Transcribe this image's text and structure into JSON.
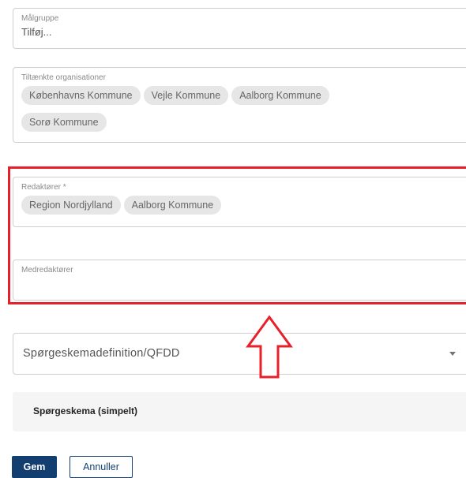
{
  "form": {
    "malgruppe": {
      "label": "Målgruppe",
      "placeholder": "Tilføj..."
    },
    "tiltaenkte": {
      "label": "Tiltænkte organisationer",
      "chips": [
        "Københavns Kommune",
        "Vejle Kommune",
        "Aalborg Kommune",
        "Sorø Kommune"
      ]
    },
    "redaktorer": {
      "label": "Redaktører *",
      "chips": [
        "Region Nordjylland",
        "Aalborg Kommune"
      ]
    },
    "medredaktorer": {
      "label": "Medredaktører"
    },
    "questionnaire_select": {
      "value": "Spørgeskemadefinition/QFDD"
    },
    "panel": {
      "title": "Spørgeskema (simpelt)"
    },
    "buttons": {
      "save": "Gem",
      "cancel": "Annuller"
    }
  },
  "colors": {
    "highlight": "#e8202a",
    "primary": "#123f70",
    "chip": "#e6e6e6"
  },
  "icons": {
    "dropdown": "chevron-down-icon",
    "annotation": "arrow-up-icon"
  }
}
